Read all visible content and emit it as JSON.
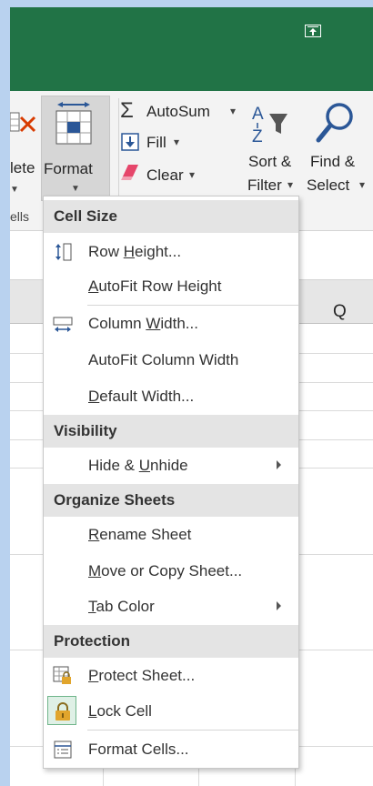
{
  "ribbon": {
    "delete_label": "lete",
    "format_label": "Format",
    "autosum_label": "AutoSum",
    "fill_label": "Fill",
    "clear_label": "Clear",
    "sort_label_1": "Sort &",
    "sort_label_2": "Filter",
    "find_label_1": "Find &",
    "find_label_2": "Select",
    "cells_group_label": "ells",
    "dropdown_glyph": "▾",
    "small_arrow": "▼"
  },
  "sheet": {
    "column_label": "Q"
  },
  "menu": {
    "sections": [
      {
        "header": "Cell Size",
        "items": [
          {
            "label": "Row Height...",
            "accel": "H",
            "icon": "row-height-icon"
          },
          {
            "label": "AutoFit Row Height",
            "accel": "A",
            "icon": ""
          },
          {
            "label": "Column Width...",
            "accel": "W",
            "icon": "column-width-icon"
          },
          {
            "label": "AutoFit Column Width",
            "accel": "I",
            "icon": ""
          },
          {
            "label": "Default Width...",
            "accel": "D",
            "icon": ""
          }
        ]
      },
      {
        "header": "Visibility",
        "items": [
          {
            "label": "Hide & Unhide",
            "accel": "U",
            "icon": "",
            "submenu": true
          }
        ]
      },
      {
        "header": "Organize Sheets",
        "items": [
          {
            "label": "Rename Sheet",
            "accel": "R",
            "icon": ""
          },
          {
            "label": "Move or Copy Sheet...",
            "accel": "M",
            "icon": ""
          },
          {
            "label": "Tab Color",
            "accel": "T",
            "icon": "",
            "submenu": true
          }
        ]
      },
      {
        "header": "Protection",
        "items": [
          {
            "label": "Protect Sheet...",
            "accel": "P",
            "icon": "protect-sheet-icon"
          },
          {
            "label": "Lock Cell",
            "accel": "L",
            "icon": "lock-icon"
          },
          {
            "label": "Format Cells...",
            "accel": "E",
            "icon": "format-cells-icon"
          }
        ]
      }
    ]
  },
  "colors": {
    "titlebar": "#217346",
    "accent_blue": "#2b5797",
    "lock_gold": "#e1a52c"
  }
}
